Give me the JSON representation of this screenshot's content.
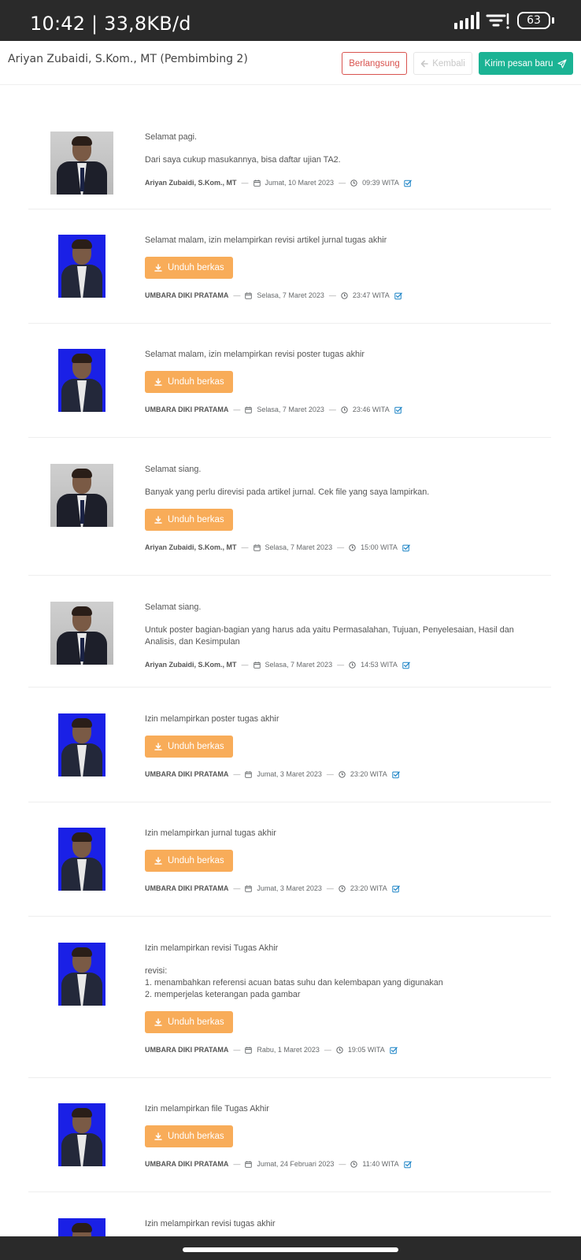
{
  "status_bar": {
    "time": "10:42 | 33,8KB/d",
    "battery": "63"
  },
  "header": {
    "title": "Ariyan Zubaidi, S.Kom., MT (Pembimbing 2)",
    "status_label": "Berlangsung",
    "back_label": "Kembali",
    "send_label": "Kirim pesan baru"
  },
  "download_label": "Unduh berkas",
  "messages": [
    {
      "author": "Ariyan Zubaidi, S.Kom., MT",
      "role": "lecturer",
      "paragraphs": [
        "Selamat pagi.",
        "Dari saya cukup masukannya, bisa daftar ujian TA2."
      ],
      "attachment": false,
      "date": "Jumat, 10 Maret 2023",
      "time": "09:39 WITA"
    },
    {
      "author": "UMBARA DIKI PRATAMA",
      "role": "student",
      "paragraphs": [
        "Selamat malam, izin melampirkan revisi artikel jurnal tugas akhir"
      ],
      "attachment": true,
      "date": "Selasa, 7 Maret 2023",
      "time": "23:47 WITA"
    },
    {
      "author": "UMBARA DIKI PRATAMA",
      "role": "student",
      "paragraphs": [
        "Selamat malam, izin melampirkan revisi poster tugas akhir"
      ],
      "attachment": true,
      "date": "Selasa, 7 Maret 2023",
      "time": "23:46 WITA"
    },
    {
      "author": "Ariyan Zubaidi, S.Kom., MT",
      "role": "lecturer",
      "paragraphs": [
        "Selamat siang.",
        "Banyak yang perlu direvisi pada artikel jurnal. Cek file yang saya lampirkan."
      ],
      "attachment": true,
      "date": "Selasa, 7 Maret 2023",
      "time": "15:00 WITA"
    },
    {
      "author": "Ariyan Zubaidi, S.Kom., MT",
      "role": "lecturer",
      "paragraphs": [
        "Selamat siang.",
        "Untuk poster bagian-bagian yang harus ada yaitu Permasalahan, Tujuan, Penyelesaian, Hasil dan Analisis, dan Kesimpulan"
      ],
      "attachment": false,
      "date": "Selasa, 7 Maret 2023",
      "time": "14:53 WITA"
    },
    {
      "author": "UMBARA DIKI PRATAMA",
      "role": "student",
      "paragraphs": [
        "Izin melampirkan poster tugas akhir"
      ],
      "attachment": true,
      "date": "Jumat, 3 Maret 2023",
      "time": "23:20 WITA"
    },
    {
      "author": "UMBARA DIKI PRATAMA",
      "role": "student",
      "paragraphs": [
        "Izin melampirkan jurnal tugas akhir"
      ],
      "attachment": true,
      "date": "Jumat, 3 Maret 2023",
      "time": "23:20 WITA"
    },
    {
      "author": "UMBARA DIKI PRATAMA",
      "role": "student",
      "paragraphs": [
        "Izin melampirkan revisi Tugas Akhir",
        "revisi:\n1. menambahkan referensi acuan batas suhu dan kelembapan yang digunakan\n2. memperjelas keterangan pada gambar"
      ],
      "attachment": true,
      "date": "Rabu, 1 Maret 2023",
      "time": "19:05 WITA"
    },
    {
      "author": "UMBARA DIKI PRATAMA",
      "role": "student",
      "paragraphs": [
        "Izin melampirkan file Tugas Akhir"
      ],
      "attachment": true,
      "date": "Jumat, 24 Februari 2023",
      "time": "11:40 WITA"
    },
    {
      "author": "UMBARA DIKI PRATAMA",
      "role": "student",
      "paragraphs": [
        "Izin melampirkan revisi tugas akhir"
      ],
      "attachment": false,
      "date": "",
      "time": ""
    }
  ],
  "colors": {
    "accent_green": "#1bb394",
    "danger_red": "#d9534f",
    "download_orange": "#f8ac59",
    "check_blue": "#1c84c6"
  }
}
